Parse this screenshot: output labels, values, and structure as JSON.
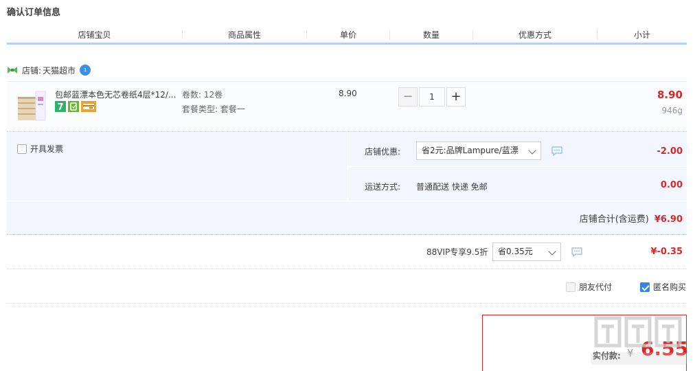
{
  "page": {
    "title": "确认订单信息"
  },
  "columns": [
    "店铺宝贝",
    "商品属性",
    "单价",
    "数量",
    "优惠方式",
    "小计"
  ],
  "shop": {
    "label": "店铺:",
    "name": "天猫超市",
    "badge": "1"
  },
  "item": {
    "title": "包邮蓝漂本色无芯卷纸4层*12/...",
    "tags": [
      "seven-day-return-icon",
      "quality-guarantee-icon",
      "credit-card-icon"
    ],
    "attrs": [
      {
        "label": "卷数:",
        "value": "12卷"
      },
      {
        "label": "套餐类型:",
        "value": "套餐一"
      }
    ],
    "price": "8.90",
    "quantity": "1",
    "minus": "−",
    "plus": "+",
    "subtotal": "8.90",
    "weight": "946g"
  },
  "invoice": {
    "label": "开具发票",
    "checked": false
  },
  "shop_promo": {
    "label": "店铺优惠:",
    "selected": "省2元:品牌Lampure/蓝漂",
    "value": "-2.00"
  },
  "shipping": {
    "label": "运送方式:",
    "method": "普通配送 快递 免邮",
    "value": "0.00"
  },
  "shop_total": {
    "label": "店铺合计(含运费)",
    "value": "¥6.90"
  },
  "vip": {
    "label": "88VIP专享9.5折",
    "selected": "省0.35元",
    "value": "¥-0.35"
  },
  "options": {
    "friend_pay": {
      "label": "朋友代付",
      "checked": false
    },
    "anonymous": {
      "label": "匿名购买",
      "checked": true
    }
  },
  "payment": {
    "label": "实付款:",
    "currency": "¥",
    "amount": "6.55"
  },
  "colors": {
    "accent_red": "#dd2727",
    "header_blue": "#b2d1ff",
    "promo_bg": "#f2f7ff",
    "checkbox_blue": "#3a83de"
  }
}
